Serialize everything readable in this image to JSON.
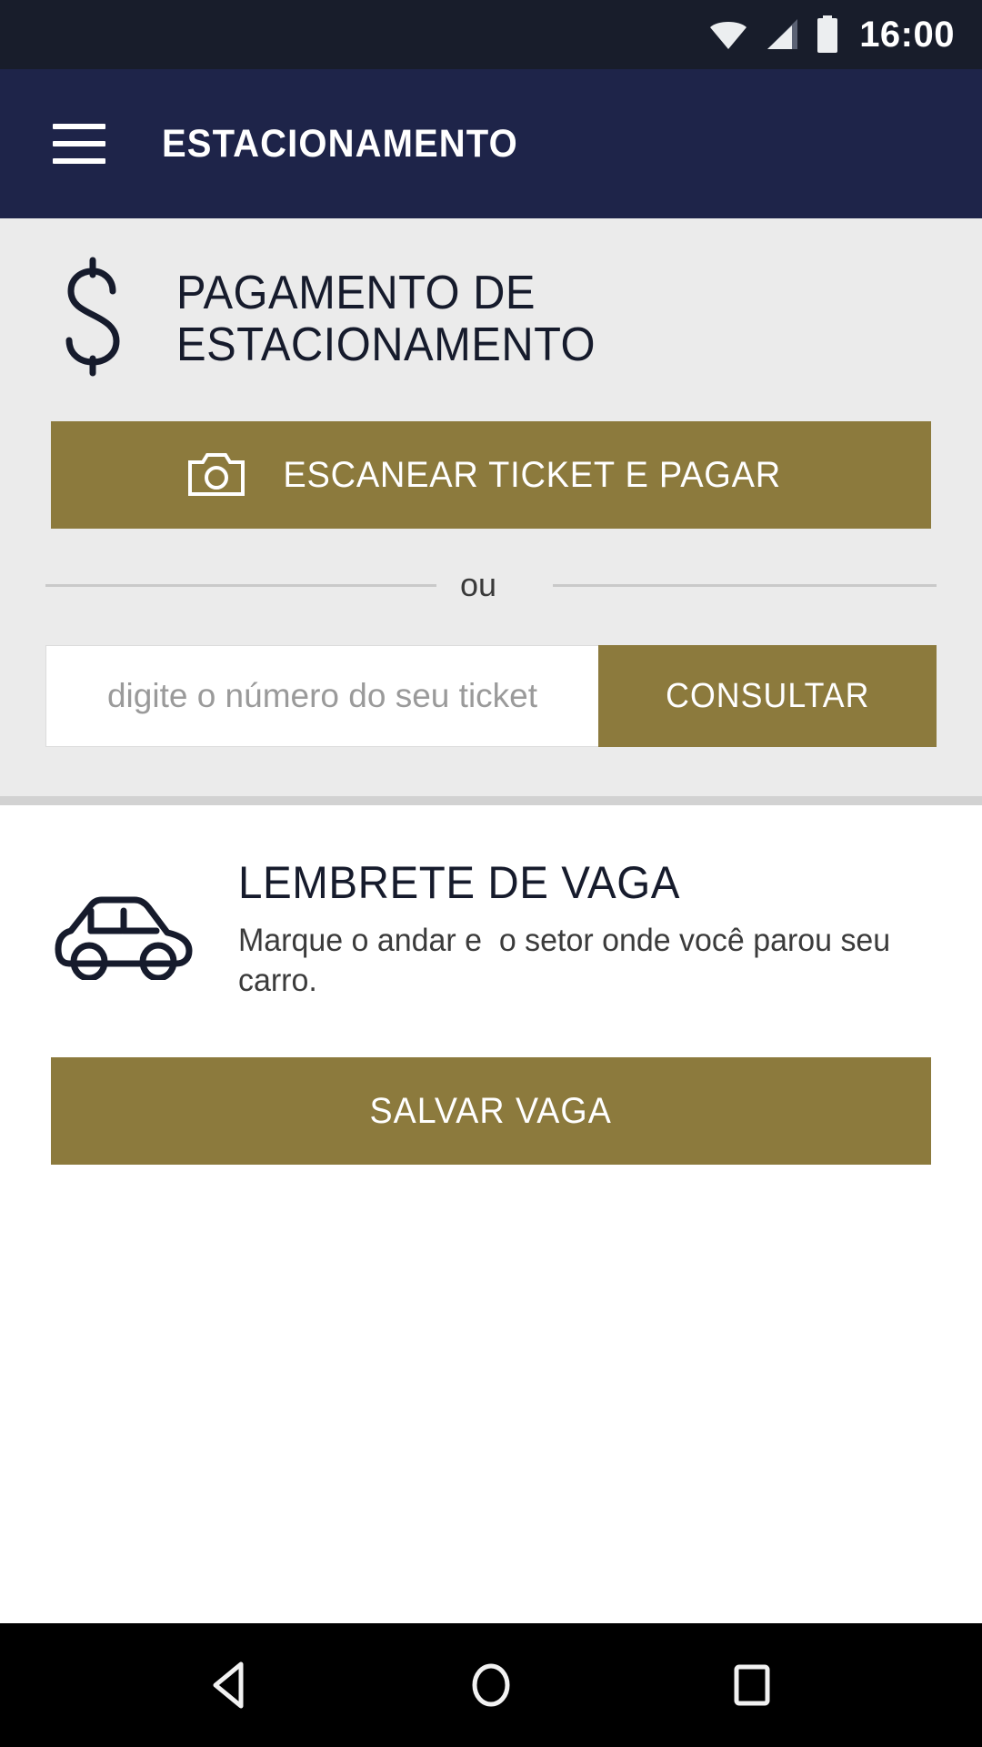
{
  "statusbar": {
    "time": "16:00",
    "icons": [
      "wifi-icon",
      "cellular-signal-icon",
      "battery-icon"
    ]
  },
  "appbar": {
    "menu_icon": "hamburger-menu-icon",
    "title": "ESTACIONAMENTO"
  },
  "payment_section": {
    "icon": "dollar-sign-icon",
    "title": "PAGAMENTO DE ESTACIONAMENTO",
    "scan_button": {
      "icon": "camera-icon",
      "label": "ESCANEAR TICKET E PAGAR"
    },
    "divider_text": "ou",
    "ticket_input": {
      "value": "",
      "placeholder": "digite o número do seu ticket"
    },
    "consult_button_label": "CONSULTAR"
  },
  "reminder_section": {
    "icon": "car-icon",
    "title": "LEMBRETE DE VAGA",
    "description": "Marque o andar e  o setor onde você parou seu carro.",
    "save_button_label": "SALVAR VAGA"
  },
  "navbar": {
    "back": "back-triangle-icon",
    "home": "home-circle-icon",
    "recents": "recents-square-icon"
  },
  "colors": {
    "statusbar_bg": "#181d2b",
    "appbar_bg": "#1e2449",
    "accent_gold": "#8c7a3d",
    "section_bg": "#ebebeb",
    "text_dark": "#161b2c"
  }
}
